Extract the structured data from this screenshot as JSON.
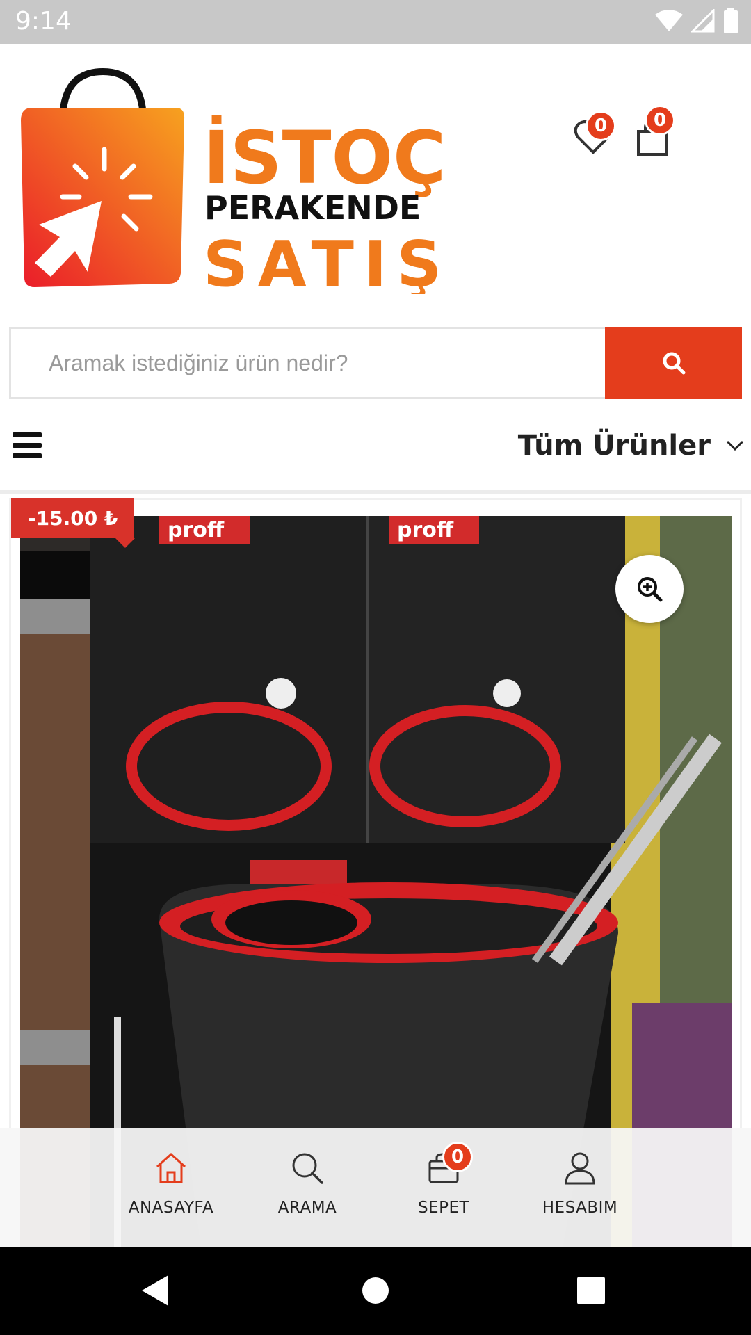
{
  "status_bar": {
    "time": "9:14"
  },
  "header": {
    "logo": {
      "line1": "İSTOÇ",
      "line2": "PERAKENDE",
      "line3": "SATIŞ"
    },
    "wishlist_count": "0",
    "cart_count": "0"
  },
  "search": {
    "placeholder": "Aramak istediğiniz ürün nedir?"
  },
  "category": {
    "selected": "Tüm Ürünler"
  },
  "product": {
    "discount_label": "-15.00 ₺",
    "image_text": "proff"
  },
  "bottom_nav": {
    "items": [
      {
        "label": "ANASAYFA",
        "icon": "home-icon",
        "active": true
      },
      {
        "label": "ARAMA",
        "icon": "search-icon"
      },
      {
        "label": "SEPET",
        "icon": "cart-icon",
        "badge": "0"
      },
      {
        "label": "HESABIM",
        "icon": "user-icon"
      }
    ]
  },
  "colors": {
    "accent": "#e43d1c",
    "logo_orange": "#f07a1c"
  }
}
